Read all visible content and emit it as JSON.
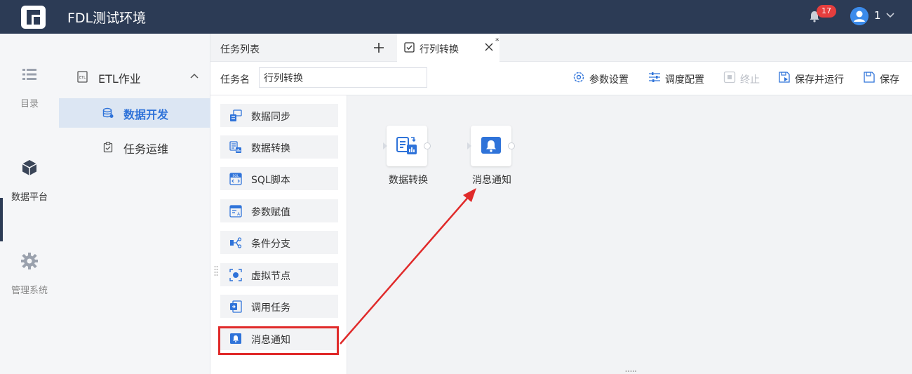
{
  "header": {
    "app_title": "FDL测试环境",
    "notifications_count": "17",
    "user_name": "1",
    "logo_icon": "fanruan-logo",
    "bg_color": "#2c3b55"
  },
  "rail": {
    "items": [
      {
        "label": "目录",
        "icon": "list-icon"
      },
      {
        "label": "数据平台",
        "icon": "cube-icon"
      },
      {
        "label": "管理系统",
        "icon": "gear-icon"
      }
    ]
  },
  "subnav": {
    "group_label": "ETL作业",
    "items": [
      {
        "label": "数据开发",
        "icon": "database-icon",
        "active": true
      },
      {
        "label": "任务运维",
        "icon": "clipboard-icon"
      }
    ]
  },
  "tabs": {
    "list_label": "任务列表",
    "active_label": "行列转换",
    "dirty_mark": "*"
  },
  "toolbar": {
    "task_name_label": "任务名",
    "task_name_value": "行列转换",
    "params_label": "参数设置",
    "schedule_label": "调度配置",
    "stop_label": "终止",
    "save_run_label": "保存并运行",
    "save_label": "保存"
  },
  "palette": {
    "items": [
      {
        "label": "数据同步",
        "icon": "data-sync-icon"
      },
      {
        "label": "数据转换",
        "icon": "data-transform-icon"
      },
      {
        "label": "SQL脚本",
        "icon": "sql-script-icon"
      },
      {
        "label": "参数赋值",
        "icon": "param-assign-icon"
      },
      {
        "label": "条件分支",
        "icon": "condition-branch-icon"
      },
      {
        "label": "虚拟节点",
        "icon": "virtual-node-icon"
      },
      {
        "label": "调用任务",
        "icon": "call-task-icon"
      },
      {
        "label": "消息通知",
        "icon": "message-notify-icon"
      }
    ]
  },
  "canvas": {
    "nodes": [
      {
        "label": "数据转换",
        "icon": "data-transform-icon"
      },
      {
        "label": "消息通知",
        "icon": "message-notify-icon"
      }
    ]
  },
  "colors": {
    "accent": "#2f73d9",
    "highlight": "#e02a2a",
    "canvas_bg": "#f2f3f5"
  }
}
